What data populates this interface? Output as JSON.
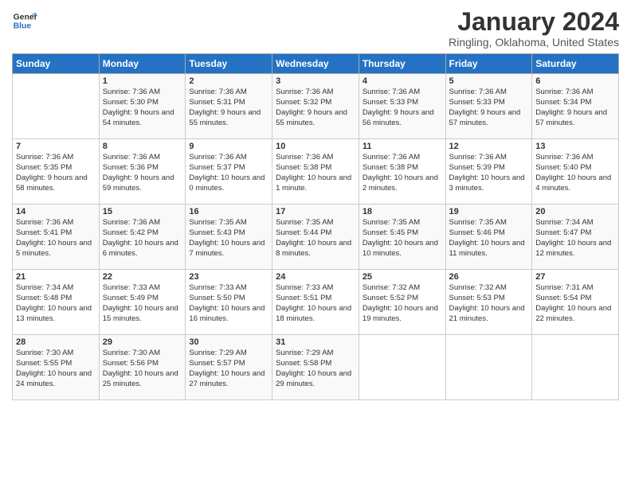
{
  "logo": {
    "line1": "General",
    "line2": "Blue"
  },
  "title": "January 2024",
  "location": "Ringling, Oklahoma, United States",
  "headers": [
    "Sunday",
    "Monday",
    "Tuesday",
    "Wednesday",
    "Thursday",
    "Friday",
    "Saturday"
  ],
  "weeks": [
    [
      {
        "day": "",
        "sunrise": "",
        "sunset": "",
        "daylight": ""
      },
      {
        "day": "1",
        "sunrise": "Sunrise: 7:36 AM",
        "sunset": "Sunset: 5:30 PM",
        "daylight": "Daylight: 9 hours and 54 minutes."
      },
      {
        "day": "2",
        "sunrise": "Sunrise: 7:36 AM",
        "sunset": "Sunset: 5:31 PM",
        "daylight": "Daylight: 9 hours and 55 minutes."
      },
      {
        "day": "3",
        "sunrise": "Sunrise: 7:36 AM",
        "sunset": "Sunset: 5:32 PM",
        "daylight": "Daylight: 9 hours and 55 minutes."
      },
      {
        "day": "4",
        "sunrise": "Sunrise: 7:36 AM",
        "sunset": "Sunset: 5:33 PM",
        "daylight": "Daylight: 9 hours and 56 minutes."
      },
      {
        "day": "5",
        "sunrise": "Sunrise: 7:36 AM",
        "sunset": "Sunset: 5:33 PM",
        "daylight": "Daylight: 9 hours and 57 minutes."
      },
      {
        "day": "6",
        "sunrise": "Sunrise: 7:36 AM",
        "sunset": "Sunset: 5:34 PM",
        "daylight": "Daylight: 9 hours and 57 minutes."
      }
    ],
    [
      {
        "day": "7",
        "sunrise": "Sunrise: 7:36 AM",
        "sunset": "Sunset: 5:35 PM",
        "daylight": "Daylight: 9 hours and 58 minutes."
      },
      {
        "day": "8",
        "sunrise": "Sunrise: 7:36 AM",
        "sunset": "Sunset: 5:36 PM",
        "daylight": "Daylight: 9 hours and 59 minutes."
      },
      {
        "day": "9",
        "sunrise": "Sunrise: 7:36 AM",
        "sunset": "Sunset: 5:37 PM",
        "daylight": "Daylight: 10 hours and 0 minutes."
      },
      {
        "day": "10",
        "sunrise": "Sunrise: 7:36 AM",
        "sunset": "Sunset: 5:38 PM",
        "daylight": "Daylight: 10 hours and 1 minute."
      },
      {
        "day": "11",
        "sunrise": "Sunrise: 7:36 AM",
        "sunset": "Sunset: 5:38 PM",
        "daylight": "Daylight: 10 hours and 2 minutes."
      },
      {
        "day": "12",
        "sunrise": "Sunrise: 7:36 AM",
        "sunset": "Sunset: 5:39 PM",
        "daylight": "Daylight: 10 hours and 3 minutes."
      },
      {
        "day": "13",
        "sunrise": "Sunrise: 7:36 AM",
        "sunset": "Sunset: 5:40 PM",
        "daylight": "Daylight: 10 hours and 4 minutes."
      }
    ],
    [
      {
        "day": "14",
        "sunrise": "Sunrise: 7:36 AM",
        "sunset": "Sunset: 5:41 PM",
        "daylight": "Daylight: 10 hours and 5 minutes."
      },
      {
        "day": "15",
        "sunrise": "Sunrise: 7:36 AM",
        "sunset": "Sunset: 5:42 PM",
        "daylight": "Daylight: 10 hours and 6 minutes."
      },
      {
        "day": "16",
        "sunrise": "Sunrise: 7:35 AM",
        "sunset": "Sunset: 5:43 PM",
        "daylight": "Daylight: 10 hours and 7 minutes."
      },
      {
        "day": "17",
        "sunrise": "Sunrise: 7:35 AM",
        "sunset": "Sunset: 5:44 PM",
        "daylight": "Daylight: 10 hours and 8 minutes."
      },
      {
        "day": "18",
        "sunrise": "Sunrise: 7:35 AM",
        "sunset": "Sunset: 5:45 PM",
        "daylight": "Daylight: 10 hours and 10 minutes."
      },
      {
        "day": "19",
        "sunrise": "Sunrise: 7:35 AM",
        "sunset": "Sunset: 5:46 PM",
        "daylight": "Daylight: 10 hours and 11 minutes."
      },
      {
        "day": "20",
        "sunrise": "Sunrise: 7:34 AM",
        "sunset": "Sunset: 5:47 PM",
        "daylight": "Daylight: 10 hours and 12 minutes."
      }
    ],
    [
      {
        "day": "21",
        "sunrise": "Sunrise: 7:34 AM",
        "sunset": "Sunset: 5:48 PM",
        "daylight": "Daylight: 10 hours and 13 minutes."
      },
      {
        "day": "22",
        "sunrise": "Sunrise: 7:33 AM",
        "sunset": "Sunset: 5:49 PM",
        "daylight": "Daylight: 10 hours and 15 minutes."
      },
      {
        "day": "23",
        "sunrise": "Sunrise: 7:33 AM",
        "sunset": "Sunset: 5:50 PM",
        "daylight": "Daylight: 10 hours and 16 minutes."
      },
      {
        "day": "24",
        "sunrise": "Sunrise: 7:33 AM",
        "sunset": "Sunset: 5:51 PM",
        "daylight": "Daylight: 10 hours and 18 minutes."
      },
      {
        "day": "25",
        "sunrise": "Sunrise: 7:32 AM",
        "sunset": "Sunset: 5:52 PM",
        "daylight": "Daylight: 10 hours and 19 minutes."
      },
      {
        "day": "26",
        "sunrise": "Sunrise: 7:32 AM",
        "sunset": "Sunset: 5:53 PM",
        "daylight": "Daylight: 10 hours and 21 minutes."
      },
      {
        "day": "27",
        "sunrise": "Sunrise: 7:31 AM",
        "sunset": "Sunset: 5:54 PM",
        "daylight": "Daylight: 10 hours and 22 minutes."
      }
    ],
    [
      {
        "day": "28",
        "sunrise": "Sunrise: 7:30 AM",
        "sunset": "Sunset: 5:55 PM",
        "daylight": "Daylight: 10 hours and 24 minutes."
      },
      {
        "day": "29",
        "sunrise": "Sunrise: 7:30 AM",
        "sunset": "Sunset: 5:56 PM",
        "daylight": "Daylight: 10 hours and 25 minutes."
      },
      {
        "day": "30",
        "sunrise": "Sunrise: 7:29 AM",
        "sunset": "Sunset: 5:57 PM",
        "daylight": "Daylight: 10 hours and 27 minutes."
      },
      {
        "day": "31",
        "sunrise": "Sunrise: 7:29 AM",
        "sunset": "Sunset: 5:58 PM",
        "daylight": "Daylight: 10 hours and 29 minutes."
      },
      {
        "day": "",
        "sunrise": "",
        "sunset": "",
        "daylight": ""
      },
      {
        "day": "",
        "sunrise": "",
        "sunset": "",
        "daylight": ""
      },
      {
        "day": "",
        "sunrise": "",
        "sunset": "",
        "daylight": ""
      }
    ]
  ]
}
